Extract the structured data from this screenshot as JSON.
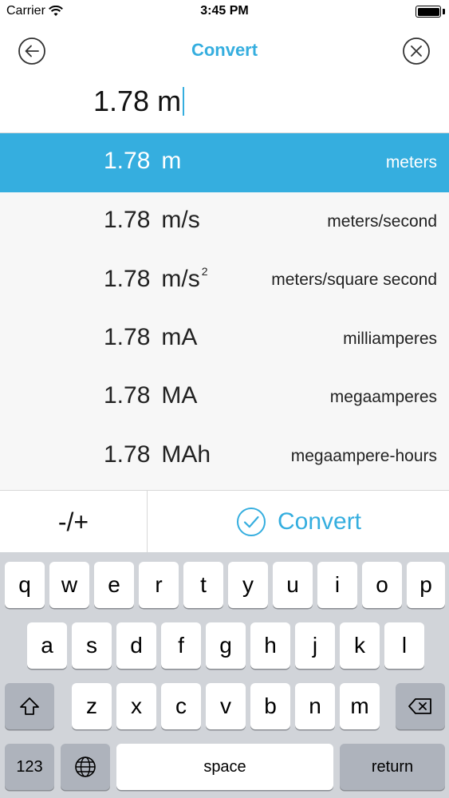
{
  "status_bar": {
    "carrier": "Carrier",
    "time": "3:45 PM",
    "battery_level": 1.0
  },
  "nav": {
    "title": "Convert",
    "back_icon": "back-arrow-circle-icon",
    "close_icon": "close-circle-icon"
  },
  "input": {
    "value": "1.78 m"
  },
  "units": [
    {
      "value": "1.78",
      "symbol": "m",
      "sup": "",
      "name": "meters",
      "selected": true
    },
    {
      "value": "1.78",
      "symbol": "m/s",
      "sup": "",
      "name": "meters/second",
      "selected": false
    },
    {
      "value": "1.78",
      "symbol": "m/s",
      "sup": "2",
      "name": "meters/square second",
      "selected": false
    },
    {
      "value": "1.78",
      "symbol": "mA",
      "sup": "",
      "name": "milliamperes",
      "selected": false
    },
    {
      "value": "1.78",
      "symbol": "MA",
      "sup": "",
      "name": "megaamperes",
      "selected": false
    },
    {
      "value": "1.78",
      "symbol": "MAh",
      "sup": "",
      "name": "megaampere-hours",
      "selected": false
    }
  ],
  "actions": {
    "sign_label": "-/+",
    "convert_label": "Convert"
  },
  "keyboard": {
    "row1": [
      "q",
      "w",
      "e",
      "r",
      "t",
      "y",
      "u",
      "i",
      "o",
      "p"
    ],
    "row2": [
      "a",
      "s",
      "d",
      "f",
      "g",
      "h",
      "j",
      "k",
      "l"
    ],
    "row3": [
      "z",
      "x",
      "c",
      "v",
      "b",
      "n",
      "m"
    ],
    "numbers_label": "123",
    "space_label": "space",
    "return_label": "return",
    "shift_icon": "shift-arrow-icon",
    "delete_icon": "delete-backspace-icon",
    "globe_icon": "globe-icon"
  },
  "colors": {
    "accent": "#35aedf",
    "list_background": "#f7f7f7",
    "keyboard_background": "#d1d4d9"
  }
}
